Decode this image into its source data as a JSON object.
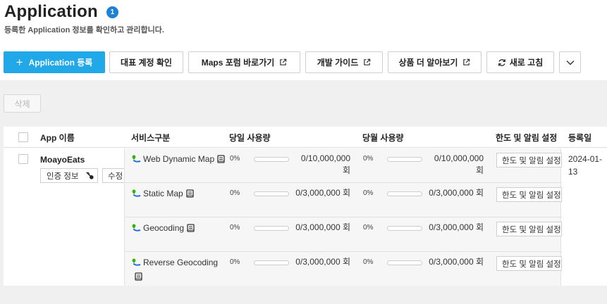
{
  "header": {
    "title": "Application",
    "count": "1",
    "description": "등록한 Application 정보를 확인하고 관리합니다."
  },
  "toolbar": {
    "register_label": "Application 등록",
    "account_label": "대표 계정 확인",
    "maps_forum_label": "Maps 포럼 바로가기",
    "dev_guide_label": "개발 가이드",
    "product_more_label": "상품 더 알아보기",
    "refresh_label": "새로 고침"
  },
  "delete_label": "삭제",
  "table": {
    "columns": {
      "app_name": "App 이름",
      "service": "서비스구분",
      "daily": "당일 사용량",
      "monthly": "당월 사용량",
      "limit": "한도 및 알림 설정",
      "date": "등록일"
    },
    "app": {
      "name": "MoayoEats",
      "auth_label": "인증 정보",
      "edit_label": "수정",
      "date": "2024-01-13"
    },
    "services": [
      {
        "name": "Web Dynamic Map",
        "daily_pct": "0%",
        "daily_fill": 0,
        "daily_usage": "0/10,000,000 회",
        "monthly_pct": "0%",
        "monthly_fill": 0,
        "monthly_usage": "0/10,000,000 회",
        "limit_label": "한도 및 알림 설정"
      },
      {
        "name": "Static Map",
        "daily_pct": "0%",
        "daily_fill": 0,
        "daily_usage": "0/3,000,000 회",
        "monthly_pct": "0%",
        "monthly_fill": 0,
        "monthly_usage": "0/3,000,000 회",
        "limit_label": "한도 및 알림 설정"
      },
      {
        "name": "Geocoding",
        "daily_pct": "0%",
        "daily_fill": 0,
        "daily_usage": "0/3,000,000 회",
        "monthly_pct": "0%",
        "monthly_fill": 0,
        "monthly_usage": "0/3,000,000 회",
        "limit_label": "한도 및 알림 설정"
      },
      {
        "name": "Reverse Geocoding",
        "daily_pct": "0%",
        "daily_fill": 0,
        "daily_usage": "0/3,000,000 회",
        "monthly_pct": "0%",
        "monthly_fill": 0,
        "monthly_usage": "0/3,000,000 회",
        "limit_label": "한도 및 알림 설정"
      }
    ]
  },
  "colors": {
    "primary": "#21a8e8",
    "badge": "#1b82d8",
    "map_icon_green": "#2db400",
    "map_icon_blue": "#1b6ee8"
  },
  "icons": {
    "register": "plus-icon",
    "external": "external-link-icon",
    "refresh": "refresh-icon",
    "more": "chevron-down-icon",
    "auth": "key-icon",
    "service": "map-pin-icon",
    "doc": "book-icon"
  }
}
